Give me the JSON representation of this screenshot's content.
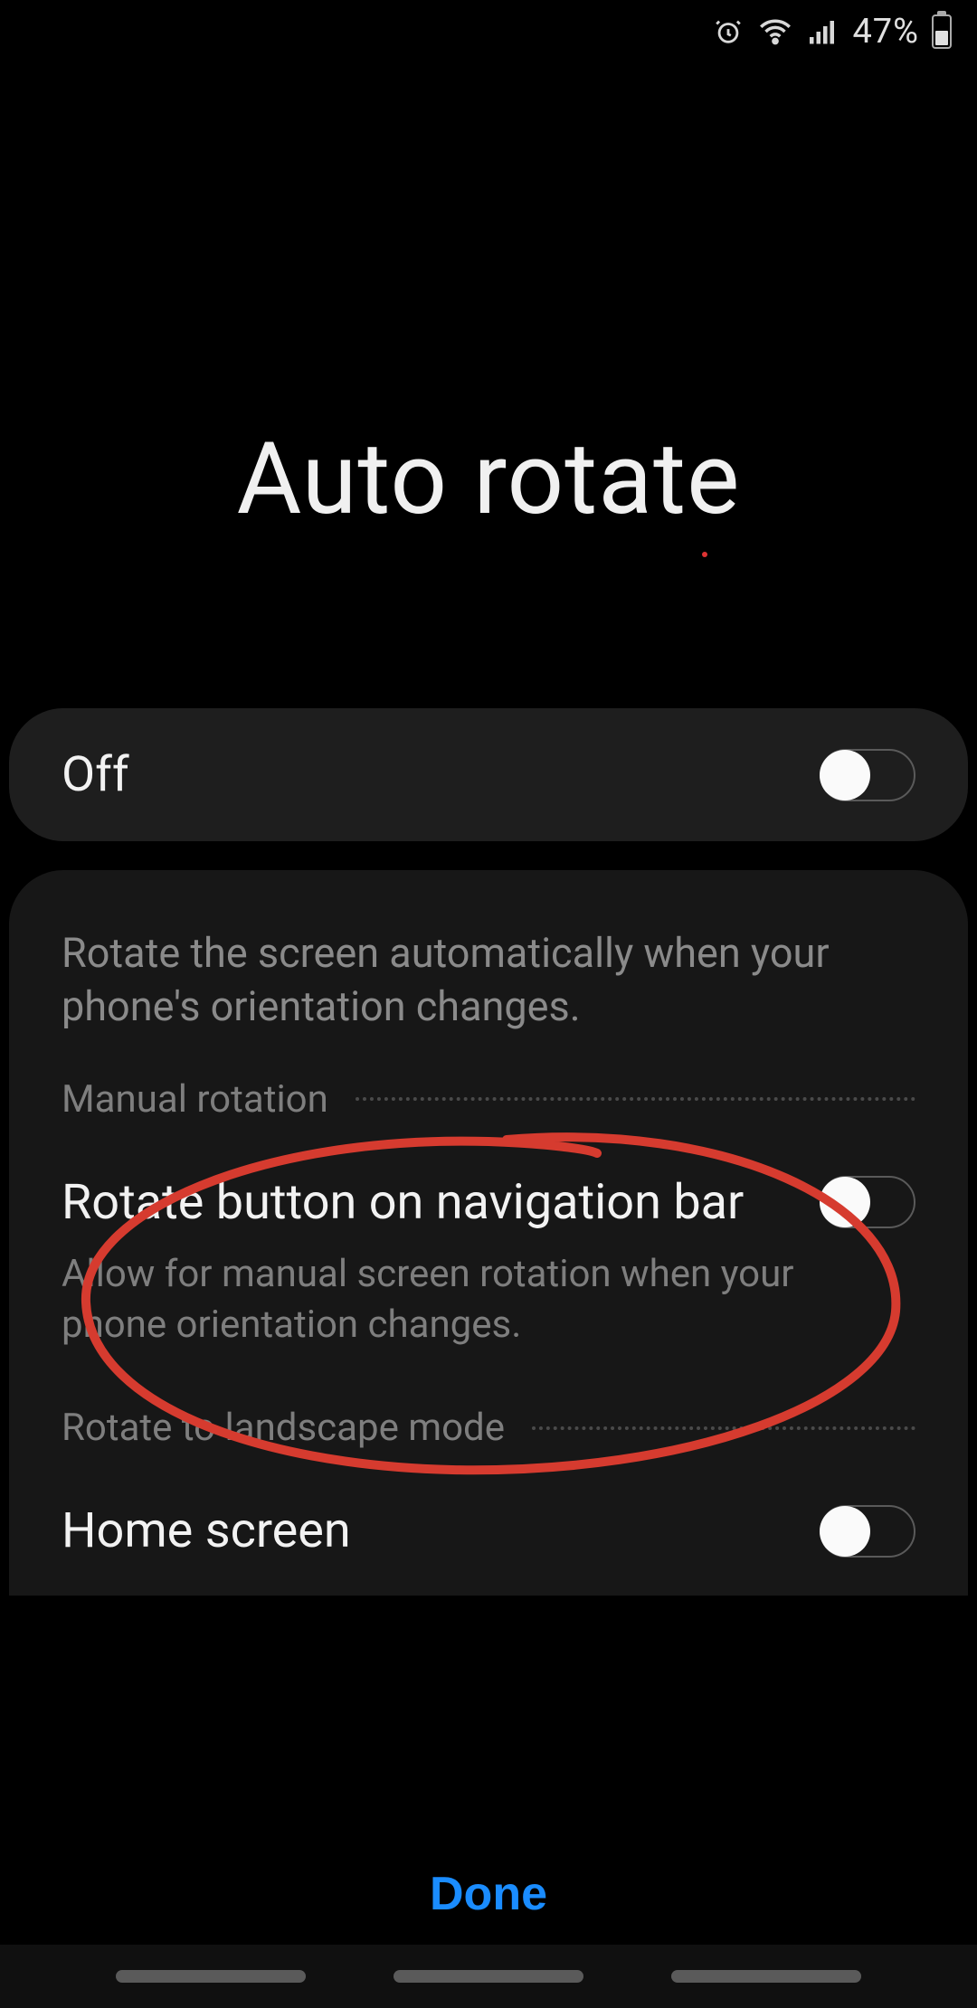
{
  "status": {
    "battery_pct": "47%",
    "icons": {
      "alarm": "alarm-icon",
      "wifi": "wifi-icon",
      "signal": "signal-icon",
      "battery": "battery-icon"
    }
  },
  "page": {
    "title": "Auto rotate"
  },
  "master_toggle": {
    "label": "Off",
    "state": "off"
  },
  "description": "Rotate the screen automatically when your phone's orientation changes.",
  "sections": {
    "manual": {
      "header": "Manual rotation",
      "item": {
        "title": "Rotate button on navigation bar",
        "subtitle": "Allow for manual screen rotation when your phone orientation changes.",
        "toggle_state": "off"
      }
    },
    "landscape": {
      "header": "Rotate to landscape mode",
      "item": {
        "title": "Home screen",
        "toggle_state": "off"
      }
    }
  },
  "footer": {
    "done": "Done"
  },
  "annotation": {
    "color": "#d63b2f"
  }
}
